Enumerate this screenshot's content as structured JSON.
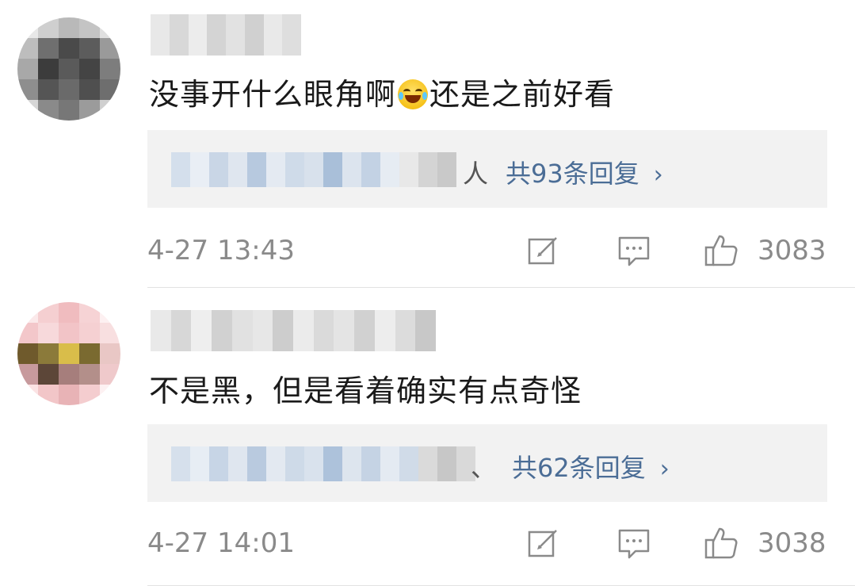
{
  "comments": [
    {
      "text_before_emoji": "没事开什么眼角啊",
      "emoji": "laughing-tears",
      "text_after_emoji": "还是之前好看",
      "reply_preview_suffix": "人",
      "reply_link": "共93条回复",
      "reply_chevron": "›",
      "timestamp": "4-27 13:43",
      "like_count": "3083"
    },
    {
      "text": "不是黑，但是看着确实有点奇怪",
      "reply_preview_suffix": "、",
      "reply_link": "共62条回复",
      "reply_chevron": "›",
      "timestamp": "4-27 14:01",
      "like_count": "3038"
    }
  ],
  "icons": {
    "repost": "edit-square-icon",
    "comment": "comment-bubble-icon",
    "like": "thumbs-up-icon"
  },
  "colors": {
    "link": "#4b6d96",
    "meta": "#8a8a8a",
    "reply_bg": "#f2f2f2",
    "text": "#1a1a1a"
  }
}
